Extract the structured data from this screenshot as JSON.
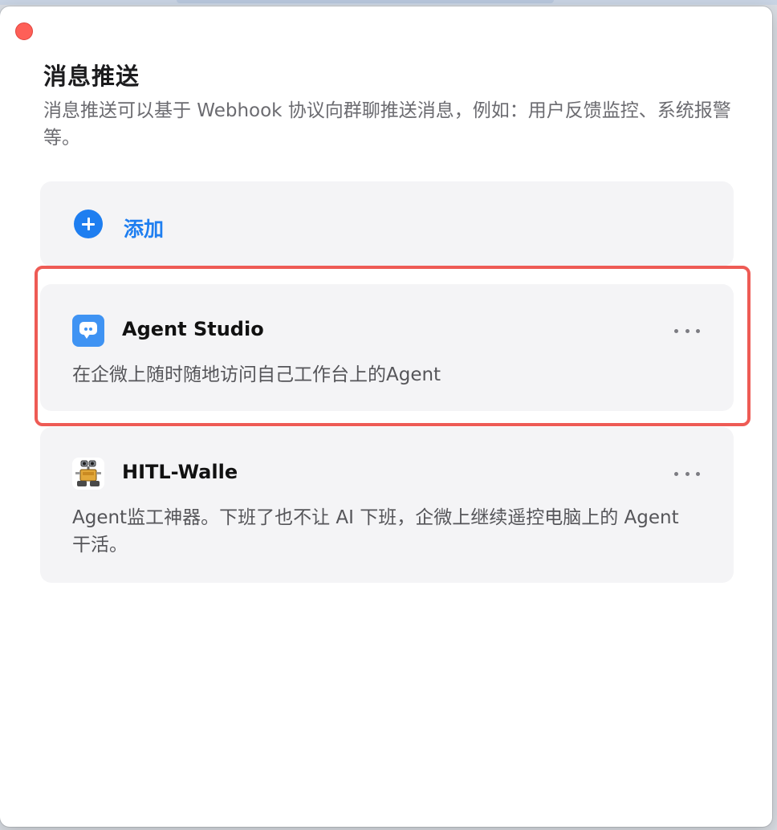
{
  "window": {
    "title": "消息推送",
    "description": "消息推送可以基于 Webhook 协议向群聊推送消息，例如：用户反馈监控、系统报警等。",
    "close_button_color": "#fe5f57"
  },
  "add_card": {
    "label": "添加",
    "icon": "plus-circle-icon",
    "accent_color": "#1e7ef0"
  },
  "integrations": [
    {
      "name": "Agent Studio",
      "description": "在企微上随时随地访问自己工作台上的Agent",
      "icon": "chat-bubble-icon",
      "icon_color": "#3f93f3",
      "highlighted": true
    },
    {
      "name": "HITL-Walle",
      "description": "Agent监工神器。下班了也不让 AI 下班，企微上继续遥控电脑上的 Agent 干活。",
      "icon": "robot-walle-icon",
      "highlighted": false
    }
  ],
  "highlight_color": "#ee5b55"
}
